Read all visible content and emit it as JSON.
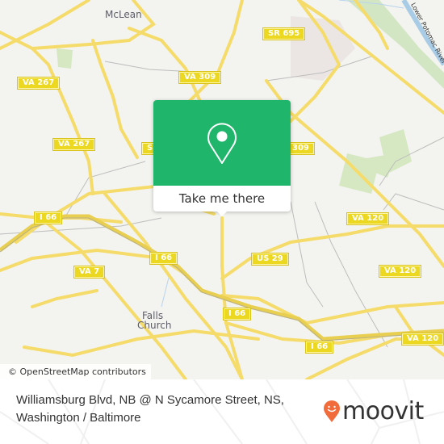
{
  "map": {
    "place_labels": {
      "mclean": "McLean",
      "falls_church_line1": "Falls",
      "falls_church_line2": "Church"
    },
    "river_label": "Lower Potomac River",
    "route_shields": [
      {
        "id": "va267-a",
        "label": "VA 267"
      },
      {
        "id": "va267-b",
        "label": "VA 267"
      },
      {
        "id": "sr695",
        "label": "SR 695"
      },
      {
        "id": "va309-a",
        "label": "VA 309"
      },
      {
        "id": "s-partial",
        "label": "S"
      },
      {
        "id": "309-partial",
        "label": "309"
      },
      {
        "id": "i66-a",
        "label": "I 66"
      },
      {
        "id": "i66-b",
        "label": "I 66"
      },
      {
        "id": "i66-c",
        "label": "I 66"
      },
      {
        "id": "i66-d",
        "label": "I 66"
      },
      {
        "id": "va7",
        "label": "VA 7"
      },
      {
        "id": "us29",
        "label": "US 29"
      },
      {
        "id": "va120-a",
        "label": "VA 120"
      },
      {
        "id": "va120-b",
        "label": "VA 120"
      },
      {
        "id": "va120-c",
        "label": "VA 120"
      }
    ],
    "attribution": "© OpenStreetMap contributors"
  },
  "popup": {
    "icon": "map-pin-icon",
    "action_label": "Take me there",
    "color": "#1fb66b"
  },
  "footer": {
    "stop_name_line1": "Williamsburg Blvd, NB @ N Sycamore Street, NS,",
    "stop_name_line2": "Washington / Baltimore",
    "brand": "moovit",
    "brand_color": "#f26b3a"
  }
}
